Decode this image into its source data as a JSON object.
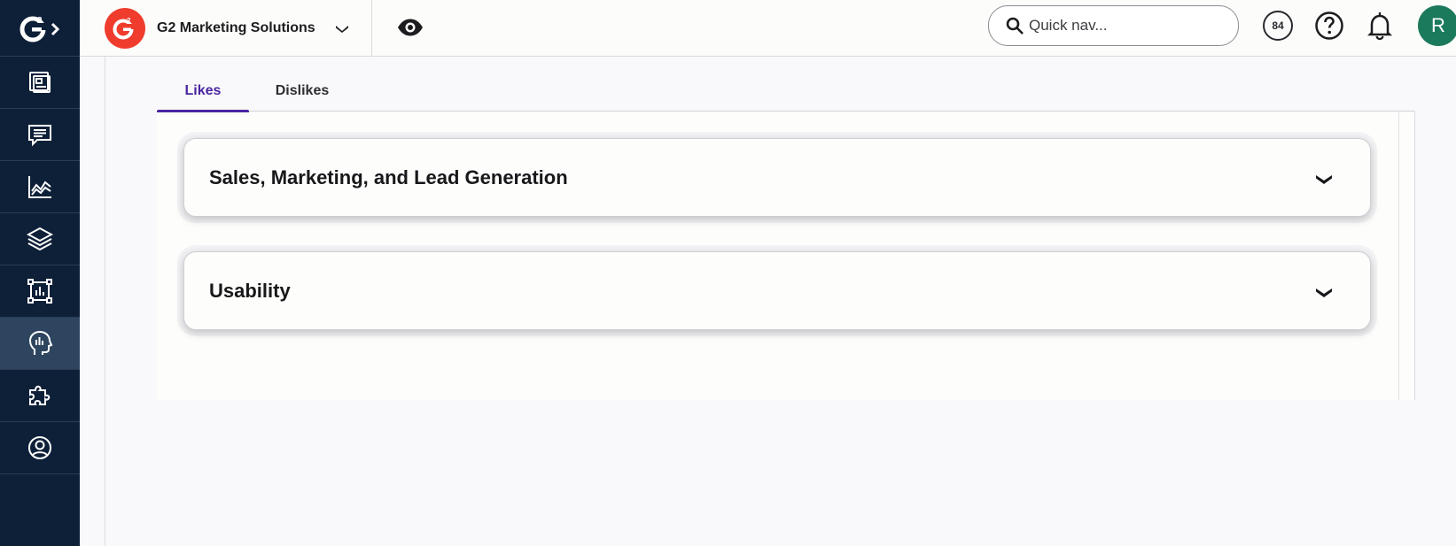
{
  "sidebar": {
    "logo": "g2-logo",
    "items": [
      {
        "icon": "dashboard-icon",
        "active": false
      },
      {
        "icon": "reviews-chat-icon",
        "active": false
      },
      {
        "icon": "analytics-chart-icon",
        "active": false
      },
      {
        "icon": "layers-icon",
        "active": false
      },
      {
        "icon": "report-frame-icon",
        "active": false
      },
      {
        "icon": "buyer-intent-head-icon",
        "active": true
      },
      {
        "icon": "integrations-puzzle-icon",
        "active": false
      },
      {
        "icon": "account-user-icon",
        "active": false
      }
    ]
  },
  "header": {
    "org_name": "G2 Marketing Solutions",
    "search_placeholder": "Quick nav...",
    "score": "84",
    "avatar_initial": "R"
  },
  "tabs": [
    {
      "label": "Likes",
      "active": true
    },
    {
      "label": "Dislikes",
      "active": false
    }
  ],
  "accordions": [
    {
      "title": "Sales, Marketing, and Lead Generation",
      "expanded": false
    },
    {
      "title": "Usability",
      "expanded": false
    }
  ],
  "colors": {
    "sidebar_bg": "#0e2038",
    "sidebar_active": "#2e4560",
    "brand_red": "#ef3c2d",
    "tab_accent": "#4a25a3",
    "avatar_bg": "#1c7a5c"
  }
}
